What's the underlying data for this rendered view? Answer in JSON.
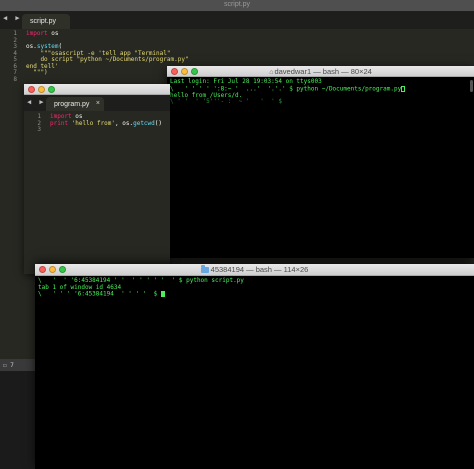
{
  "sublime_main": {
    "title": "script.py",
    "tab_arrows": "◀ ▶",
    "tab_label": "script.py",
    "line_numbers": [
      "1",
      "2",
      "3",
      "4",
      "5",
      "6",
      "7",
      "8"
    ],
    "code": {
      "line1_kw": "import",
      "line1_rest": " os",
      "line3_obj": "os.",
      "line3_fn": "system",
      "line3_rest": "(",
      "line4": "    \"\"\"osascript -e 'tell app \"Terminal\"",
      "line5": "    do script \"python ~/Documents/program.py\"",
      "line6": "end tell'",
      "line7": "  \"\"\")"
    },
    "status_text": "☐  7"
  },
  "sublime_program": {
    "tab_arrows": "◀ ▶",
    "tab_label": "program.py",
    "tab_close": "×",
    "line_numbers": [
      "1",
      "2",
      "3"
    ],
    "code": {
      "line1_kw": "import",
      "line1_rest": " os",
      "line2_kw": "print",
      "line2_str": " 'hello from'",
      "line2_rest": ", os.",
      "line2_fn": "getcwd",
      "line2_end": "()"
    }
  },
  "terminal_80": {
    "title": "davedwar1 — bash — 80×24",
    "lines": [
      "Last login: Fri Jul 28 19:03:54 on ttys003",
      "\\   ' ' ' ' ':8:~ '  ...'  '.'.' $ python ~/Documents/program.py",
      "hello from /Users/d.",
      "\\ ' '  ' '5'''- :  ~ '   '  ' $ "
    ]
  },
  "terminal_114": {
    "title": "45384194 — bash — 114×26",
    "lines": [
      "\\   '  ' '6:45384194 ' '  ' ' ' ' '  ' $ python script.py",
      "tab 1 of window id 4634",
      "\\   ' ' ' '6:45384194  ' ' ' '  $ "
    ]
  },
  "colors": {
    "terminal_text": "#49f05a",
    "terminal_bg": "#000000",
    "editor_bg": "#272822",
    "keyword": "#f92672",
    "function": "#66d9ef",
    "string": "#e6db74"
  }
}
